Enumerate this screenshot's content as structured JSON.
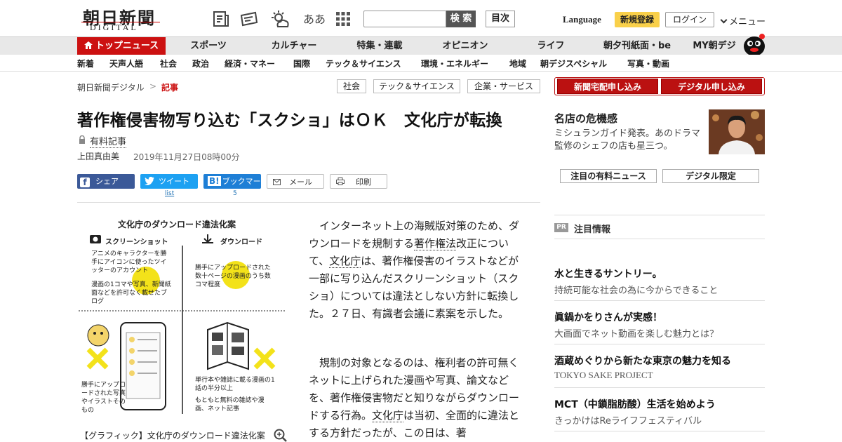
{
  "header": {
    "logo_jp": "朝日新聞",
    "logo_en": "DIGITAL",
    "icons": [
      "newspaper-icon",
      "ticket-icon",
      "weather-icon",
      "text-size-icon",
      "grid-icon"
    ],
    "text_size_label": "ああ",
    "search_placeholder": "",
    "search_button": "検 索",
    "toc_button": "目次",
    "language": "Language",
    "register": "新規登録",
    "login": "ログイン",
    "menu": "メニュー"
  },
  "global_nav": [
    "トップニュース",
    "スポーツ",
    "カルチャー",
    "特集・連載",
    "オピニオン",
    "ライフ",
    "朝夕刊紙面・be",
    "MY朝デジ"
  ],
  "sub_nav": [
    "新着",
    "天声人語",
    "社会",
    "政治",
    "経済・マネー",
    "国際",
    "テック＆サイエンス",
    "環境・エネルギー",
    "地域",
    "朝デジスペシャル",
    "写真・動画"
  ],
  "breadcrumb": {
    "home": "朝日新聞デジタル",
    "sep": ">",
    "current": "記事"
  },
  "tags": [
    "社会",
    "テック＆サイエンス",
    "企業・サービス"
  ],
  "subscribe": {
    "paper": "新聞宅配申し込み",
    "digital": "デジタル申し込み"
  },
  "article": {
    "title": "著作権侵害物写り込む「スクショ」はＯＫ　文化庁が転換",
    "paid_label": "有料記事",
    "author": "上田真由美",
    "date": "2019年11月27日08時00分",
    "share": {
      "facebook": "シェア",
      "twitter": "ツイート",
      "hatena": "ブックマーク",
      "mail": "メール",
      "print": "印刷"
    },
    "share_counts": {
      "twitter": "list",
      "hatena": "5"
    },
    "p1_a": "インターネット上の海賊版対策のため、ダウンロードを規制する",
    "p1_link1": "著作権法",
    "p1_b": "改正について、",
    "p1_link2": "文化庁",
    "p1_c": "は、著作権侵害のイラストなどが一部に写り込んだスクリーンショット（スクショ）については違法としない方針に転換した。２７日、有識者会議に素案を示した。",
    "p2_a": "規制の対象となるのは、権利者の許可無くネットに上げられた漫画や写真、論文などを、著作権侵害物だと知りながらダウンロードする行為。",
    "p2_link": "文化庁",
    "p2_b": "は当初、全面的に違法とする方針だったが、この日は、著",
    "figure": {
      "title": "文化庁のダウンロード違法化案",
      "col1_head": "スクリーンショット",
      "col2_head": "ダウンロード",
      "col1_text1": "アニメのキャラクターを勝手にアイコンに使ったツイッターのアカウント",
      "col1_text2": "漫画の1コマや写真、新聞紙面などを許可なく載せたブログ",
      "col2_text1": "勝手にアップロードされた数十ページの漫画のうち数コマ程度",
      "col1_bottom": "勝手にアップロードされた写真やイラストそのもの",
      "col2_bottom1": "単行本や雑誌に載る漫画の1話の半分以上",
      "col2_bottom2": "もともと無料の雑誌や漫画、ネット記事",
      "caption": "【グラフィック】文化庁のダウンロード違法化案"
    }
  },
  "sidebar": {
    "feature_title": "名店の危機感",
    "feature_sub": "ミシュランガイド発表。あのドラマ監修のシェフの店も星三つ。",
    "tab1": "注目の有料ニュース",
    "tab2": "デジタル限定",
    "pr_badge": "PR",
    "pr_title": "注目情報",
    "pr_items": [
      {
        "title": "水と生きるサントリー。",
        "sub": "持続可能な社会の為に今からできること"
      },
      {
        "title": "眞鍋かをりさんが実感！",
        "sub": "大画面でネット動画を楽しむ魅力とは？"
      },
      {
        "title": "酒蔵めぐりから新たな東京の魅力を知る",
        "sub": "TOKYO SAKE PROJECT"
      },
      {
        "title": "MCT（中鎖脂肪酸）生活を始めよう",
        "sub": "きっかけはReライフフェスティバル"
      }
    ]
  },
  "colors": {
    "brand_red": "#cc1111",
    "nav_gray": "#e8e8e8",
    "facebook": "#3b5998",
    "twitter": "#1da1f2",
    "hatena": "#1e7fd6",
    "register_yellow": "#f9d04a"
  }
}
